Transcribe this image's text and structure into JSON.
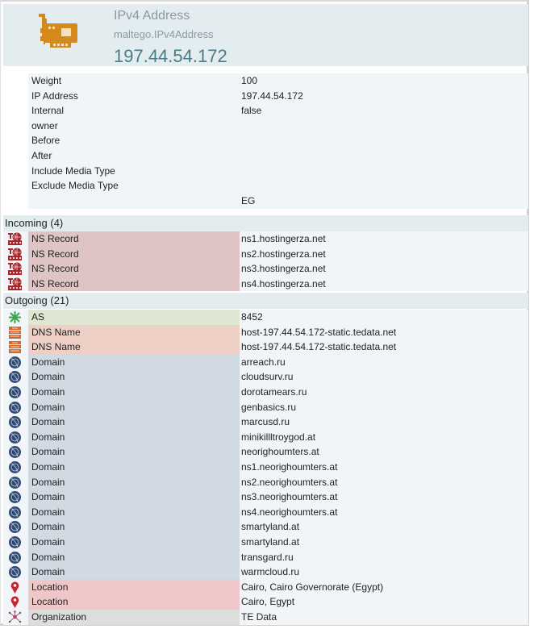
{
  "entity": {
    "type_label": "IPv4 Address",
    "type_id": "maltego.IPv4Address",
    "value": "197.44.54.172",
    "icon": "network-card-icon"
  },
  "properties": [
    {
      "key": "Weight",
      "value": "100"
    },
    {
      "key": "IP Address",
      "value": "197.44.54.172"
    },
    {
      "key": "Internal",
      "value": "false"
    },
    {
      "key": "owner",
      "value": ""
    },
    {
      "key": "Before",
      "value": ""
    },
    {
      "key": "After",
      "value": ""
    },
    {
      "key": "Include Media Type",
      "value": ""
    },
    {
      "key": "Exclude Media Type",
      "value": ""
    },
    {
      "key": "",
      "value": "EG"
    }
  ],
  "incoming": {
    "title": "Incoming (4)",
    "items": [
      {
        "type": "NS Record",
        "value": "ns1.hostingerza.net",
        "icon": "ns-record-icon",
        "color": "#dfc4c5"
      },
      {
        "type": "NS Record",
        "value": "ns2.hostingerza.net",
        "icon": "ns-record-icon",
        "color": "#dfc4c5"
      },
      {
        "type": "NS Record",
        "value": "ns3.hostingerza.net",
        "icon": "ns-record-icon",
        "color": "#dfc4c5"
      },
      {
        "type": "NS Record",
        "value": "ns4.hostingerza.net",
        "icon": "ns-record-icon",
        "color": "#dfc4c5"
      }
    ]
  },
  "outgoing": {
    "title": "Outgoing (21)",
    "items": [
      {
        "type": "AS",
        "value": "8452",
        "icon": "as-icon",
        "color": "#dfe7d3"
      },
      {
        "type": "DNS Name",
        "value": "host-197.44.54.172-static.tedata.net",
        "icon": "dns-name-icon",
        "color": "#edcfc6"
      },
      {
        "type": "DNS Name",
        "value": "host-197.44.54.172-static.tedata.net",
        "icon": "dns-name-icon",
        "color": "#edcfc6"
      },
      {
        "type": "Domain",
        "value": "arreach.ru",
        "icon": "domain-globe-icon",
        "color": "#d1d9e3"
      },
      {
        "type": "Domain",
        "value": "cloudsurv.ru",
        "icon": "domain-globe-icon",
        "color": "#d1d9e3"
      },
      {
        "type": "Domain",
        "value": "dorotamears.ru",
        "icon": "domain-globe-icon",
        "color": "#d1d9e3"
      },
      {
        "type": "Domain",
        "value": "genbasics.ru",
        "icon": "domain-globe-icon",
        "color": "#d1d9e3"
      },
      {
        "type": "Domain",
        "value": "marcusd.ru",
        "icon": "domain-globe-icon",
        "color": "#d1d9e3"
      },
      {
        "type": "Domain",
        "value": "minikillltroygod.at",
        "icon": "domain-globe-icon",
        "color": "#d1d9e3"
      },
      {
        "type": "Domain",
        "value": "neorighoumters.at",
        "icon": "domain-globe-icon",
        "color": "#d1d9e3"
      },
      {
        "type": "Domain",
        "value": "ns1.neorighoumters.at",
        "icon": "domain-globe-icon",
        "color": "#d1d9e3"
      },
      {
        "type": "Domain",
        "value": "ns2.neorighoumters.at",
        "icon": "domain-globe-icon",
        "color": "#d1d9e3"
      },
      {
        "type": "Domain",
        "value": "ns3.neorighoumters.at",
        "icon": "domain-globe-icon",
        "color": "#d1d9e3"
      },
      {
        "type": "Domain",
        "value": "ns4.neorighoumters.at",
        "icon": "domain-globe-icon",
        "color": "#d1d9e3"
      },
      {
        "type": "Domain",
        "value": "smartyland.at",
        "icon": "domain-globe-icon",
        "color": "#d1d9e3"
      },
      {
        "type": "Domain",
        "value": "smartyland.at",
        "icon": "domain-globe-icon",
        "color": "#d1d9e3"
      },
      {
        "type": "Domain",
        "value": "transgard.ru",
        "icon": "domain-globe-icon",
        "color": "#d1d9e3"
      },
      {
        "type": "Domain",
        "value": "warmcloud.ru",
        "icon": "domain-globe-icon",
        "color": "#d1d9e3"
      },
      {
        "type": "Location",
        "value": "Cairo, Cairo Governorate (Egypt)",
        "icon": "location-pin-icon",
        "color": "#efc7c8"
      },
      {
        "type": "Location",
        "value": "Cairo, Egypt",
        "icon": "location-pin-icon",
        "color": "#efc7c8"
      },
      {
        "type": "Organization",
        "value": "TE Data",
        "icon": "organization-icon",
        "color": "#dddddd"
      }
    ]
  },
  "colors": {
    "header_bg": "#e3ecef",
    "row_bg": "#f1f5f7",
    "entity_icon": "#d4891c",
    "value_text": "#4a7b86"
  }
}
